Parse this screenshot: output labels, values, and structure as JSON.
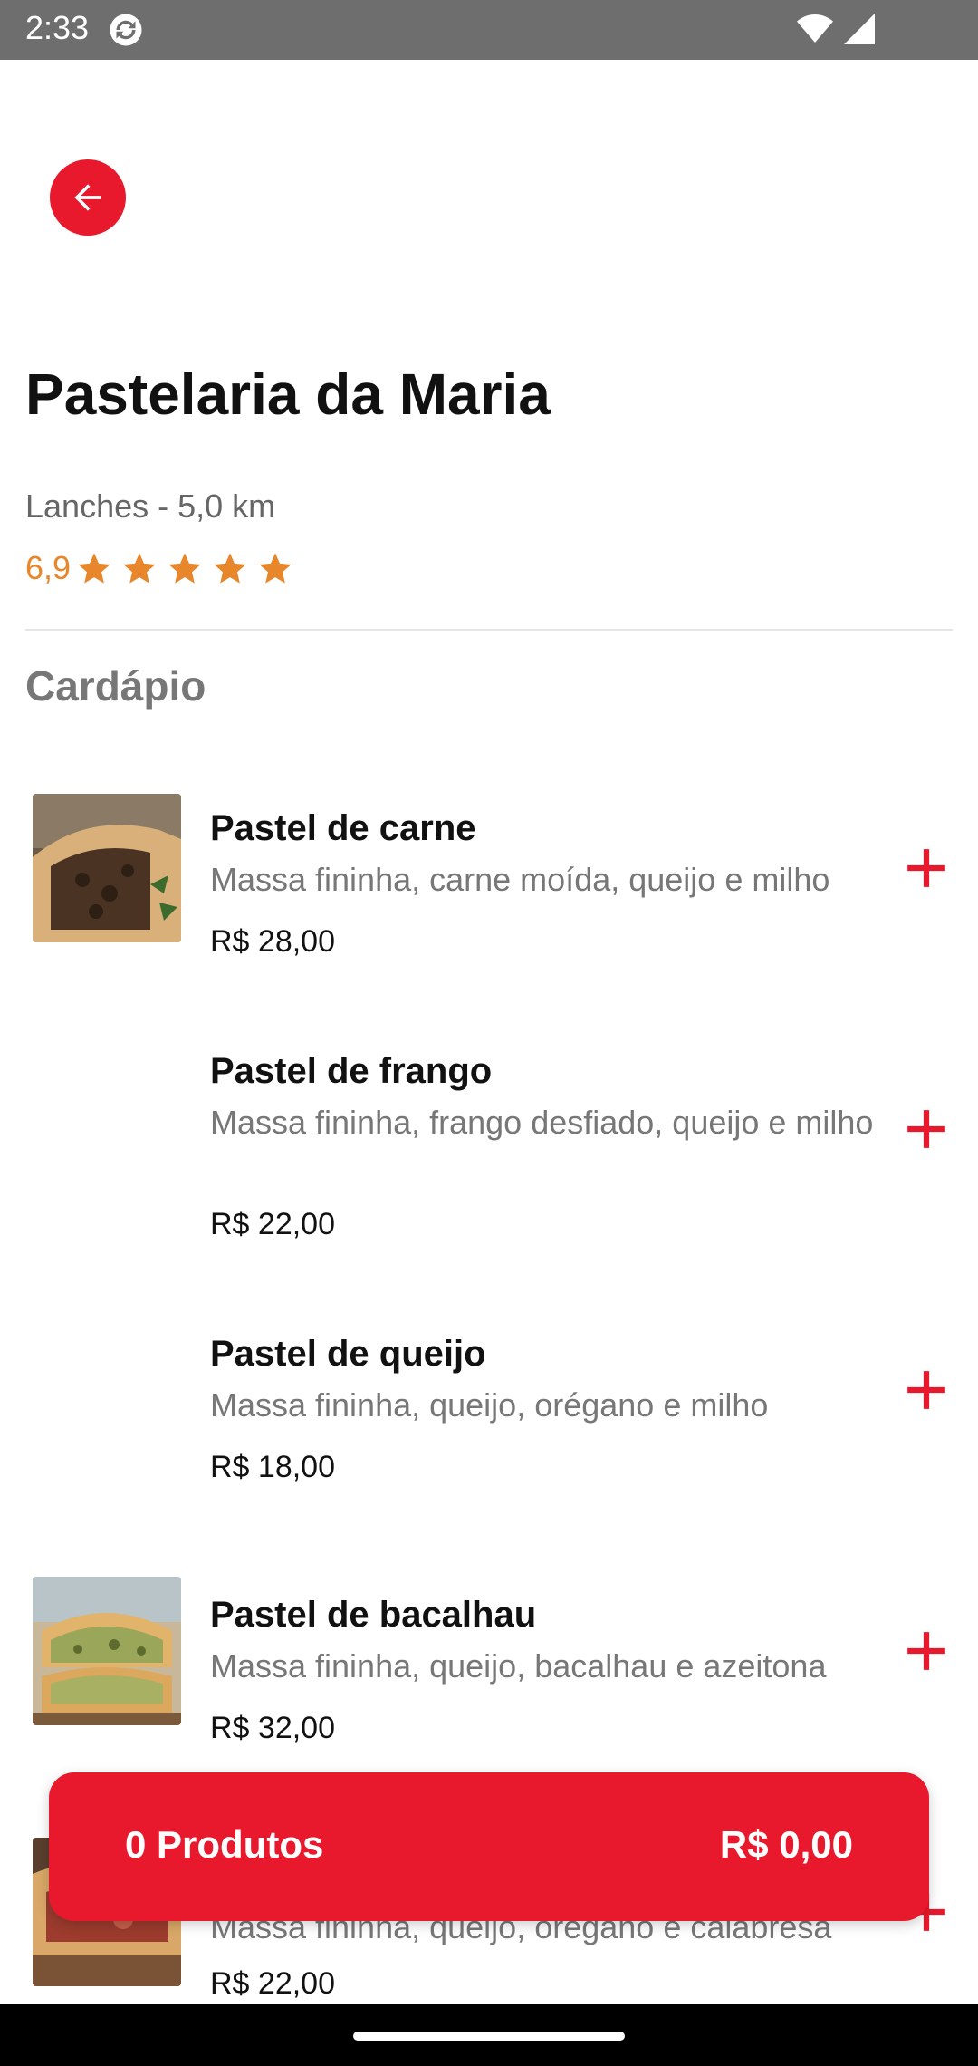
{
  "status_bar": {
    "time": "2:33"
  },
  "store": {
    "name": "Pastelaria da Maria",
    "category_distance": "Lanches - 5,0 km",
    "rating": "6,9",
    "stars": 5
  },
  "menu": {
    "title": "Cardápio",
    "items": [
      {
        "name": "Pastel de carne",
        "description": "Massa fininha, carne moída, queijo e milho",
        "price": "R$ 28,00"
      },
      {
        "name": "Pastel de frango",
        "description": "Massa fininha, frango desfiado, queijo e milho",
        "price": "R$ 22,00"
      },
      {
        "name": "Pastel de queijo",
        "description": "Massa fininha, queijo, orégano e milho",
        "price": "R$ 18,00"
      },
      {
        "name": "Pastel de bacalhau",
        "description": "Massa fininha, queijo, bacalhau e azeitona",
        "price": "R$ 32,00"
      },
      {
        "name": "",
        "description": "Massa fininha, queijo, orégano e calabresa",
        "price": "R$ 22,00"
      }
    ]
  },
  "cart": {
    "count_label": "0 Produtos",
    "total": "R$ 0,00"
  },
  "colors": {
    "accent": "#e8192c",
    "star": "#e8862c"
  }
}
